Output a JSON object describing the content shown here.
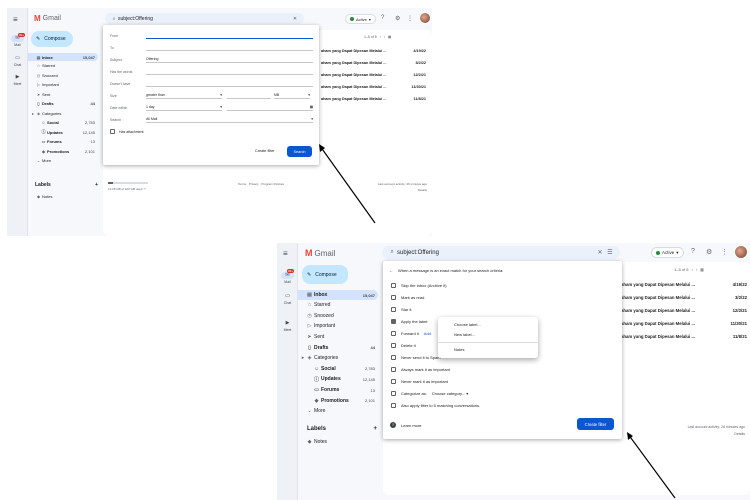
{
  "app": {
    "name": "Gmail"
  },
  "rail": {
    "mail": "Mail",
    "chat": "Chat",
    "meet": "Meet",
    "badge": "99+"
  },
  "search": {
    "query": "subject:Offering"
  },
  "status": {
    "label": "Active"
  },
  "compose": {
    "label": "Compose"
  },
  "nav": {
    "inbox": {
      "label": "Inbox",
      "count": "15,047"
    },
    "starred": {
      "label": "Starred"
    },
    "snoozed": {
      "label": "Snoozed"
    },
    "important": {
      "label": "Important"
    },
    "sent": {
      "label": "Sent"
    },
    "drafts": {
      "label": "Drafts",
      "count": "44"
    },
    "categories": {
      "label": "Categories"
    },
    "social": {
      "label": "Social",
      "count": "2,783"
    },
    "updates": {
      "label": "Updates",
      "count": "12,145"
    },
    "forums": {
      "label": "Forums",
      "count": "13"
    },
    "promotions": {
      "label": "Promotions",
      "count": "2,101"
    },
    "more": {
      "label": "More"
    }
  },
  "labels": {
    "heading": "Labels",
    "add": "+",
    "notes": "Notes"
  },
  "pager": {
    "range": "1–5 of 5"
  },
  "rows": [
    {
      "subject": "aham yang Dapat Dipesan Melalui ...",
      "date": "4/19/22"
    },
    {
      "subject": "aham yang Dapat Dipesan Melalui ...",
      "date": "3/2/22"
    },
    {
      "subject": "aham yang Dapat Dipesan Melalui ...",
      "date": "12/2/21"
    },
    {
      "subject": "aham yang Dapat Dipesan Melalui ...",
      "date": "11/30/21"
    },
    {
      "subject": "aham yang Dapat Dipesan Melalui ...",
      "date": "11/8/21"
    }
  ],
  "footer": {
    "storage": "12.06 GB of 100 GB used",
    "storage_fraction": 0.12,
    "links": "Terms · Privacy · Program Policies",
    "activity": "Last account activity: 26 minutes ago",
    "details": "Details"
  },
  "search_dialog": {
    "from": "From",
    "to": "To",
    "subject_label": "Subject",
    "subject_value": "Offering",
    "has_words": "Has the words",
    "doesnt_have": "Doesn't have",
    "size_label": "Size",
    "size_op": "greater than",
    "size_unit": "MB",
    "date_label": "Date within",
    "date_value": "1 day",
    "search_label": "Search",
    "search_value": "All Mail",
    "attachment": "Has attachment",
    "create_filter": "Create filter",
    "search_btn": "Search"
  },
  "filter_dialog": {
    "header": "When a message is an exact match for your search criteria:",
    "options": [
      {
        "label": "Skip the Inbox (Archive it)",
        "checked": false
      },
      {
        "label": "Mark as read",
        "checked": false
      },
      {
        "label": "Star it",
        "checked": false
      },
      {
        "label": "Apply the label:",
        "checked": true
      },
      {
        "label": "Forward it",
        "checked": false
      },
      {
        "label": "Delete it",
        "checked": false
      },
      {
        "label": "Never send it to Spam",
        "checked": false
      },
      {
        "label": "Always mark it as important",
        "checked": false
      },
      {
        "label": "Never mark it as important",
        "checked": false
      },
      {
        "label": "Categorize as:",
        "checked": false
      },
      {
        "label": "Also apply filter to 5 matching conversations.",
        "checked": false
      }
    ],
    "forward_link": "Add",
    "category_select": "Choose category...",
    "learn_more": "Learn more",
    "create_filter": "Create filter"
  },
  "label_menu": {
    "choose": "Choose label...",
    "new": "New label...",
    "notes": "Notes"
  },
  "colors": {
    "accent": "#0b57d0",
    "selected": "#d3e3fd",
    "compose": "#c2e7ff",
    "panel": "#f6f8fc"
  }
}
